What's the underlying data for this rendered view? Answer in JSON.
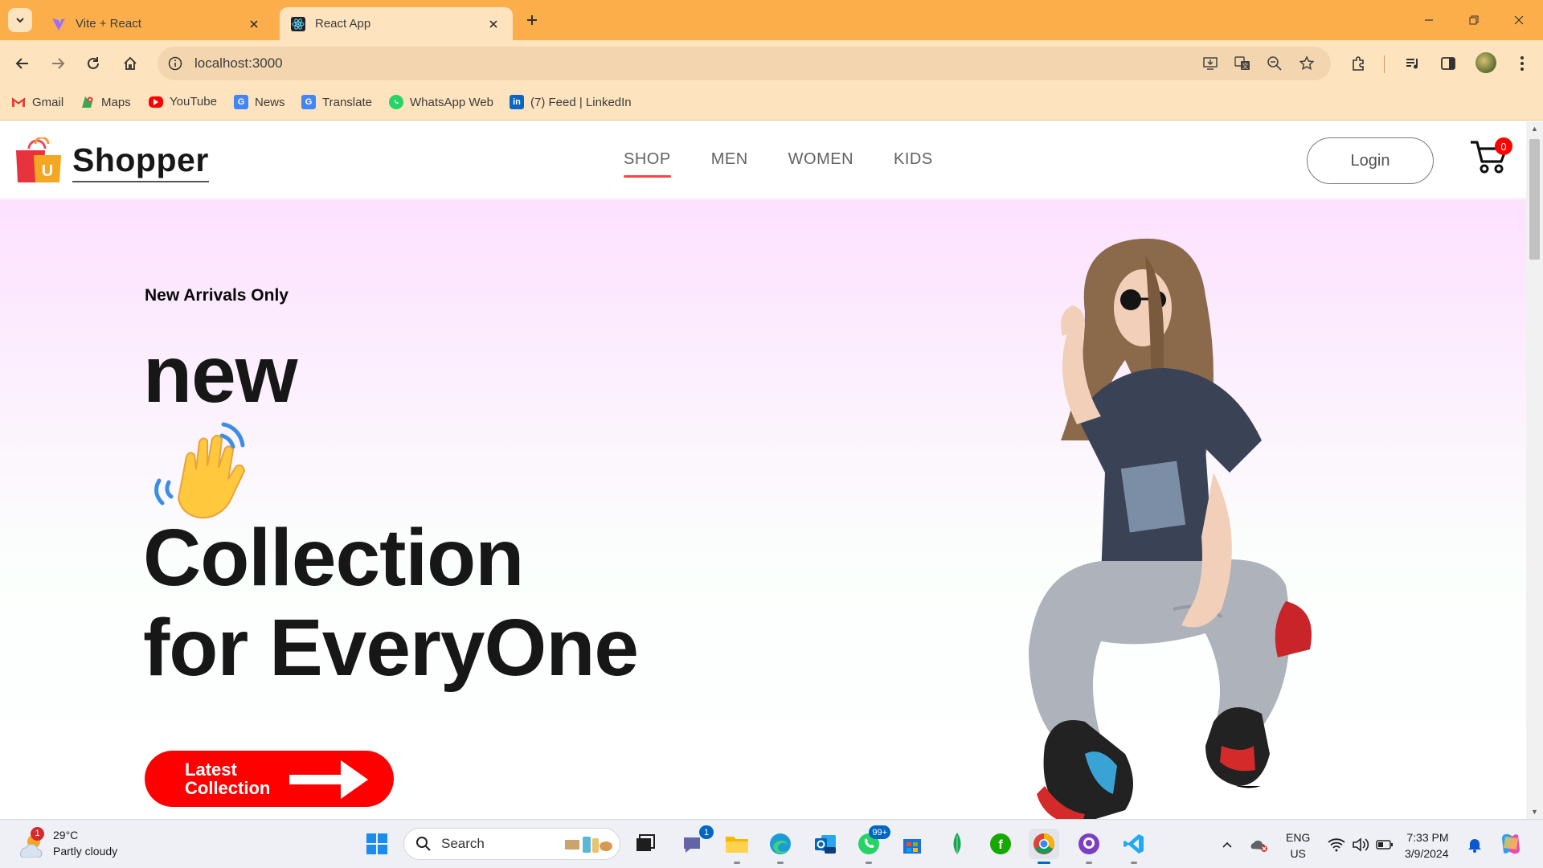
{
  "browser": {
    "tabs": [
      {
        "title": "Vite + React",
        "active": false
      },
      {
        "title": "React App",
        "active": true
      }
    ],
    "url": "localhost:3000",
    "bookmarks": [
      {
        "label": "Gmail",
        "icon": "gmail-icon"
      },
      {
        "label": "Maps",
        "icon": "maps-icon"
      },
      {
        "label": "YouTube",
        "icon": "youtube-icon"
      },
      {
        "label": "News",
        "icon": "news-icon"
      },
      {
        "label": "Translate",
        "icon": "translate-icon"
      },
      {
        "label": "WhatsApp Web",
        "icon": "whatsapp-icon"
      },
      {
        "label": "(7) Feed | LinkedIn",
        "icon": "linkedin-icon"
      }
    ]
  },
  "site": {
    "logo_text": "Shopper",
    "logo_badge": "U",
    "menu": [
      {
        "label": "SHOP",
        "active": true
      },
      {
        "label": "MEN",
        "active": false
      },
      {
        "label": "WOMEN",
        "active": false
      },
      {
        "label": "KIDS",
        "active": false
      }
    ],
    "login_label": "Login",
    "cart_count": "0",
    "colors": {
      "accent": "#ff4141",
      "cta": "#ff0000",
      "hero_top": "#fde1ff"
    }
  },
  "hero": {
    "kicker": "New Arrivals Only",
    "line1": "new",
    "line2": "Collection",
    "line3": "for EveryOne",
    "button_line1": "Latest",
    "button_line2": "Collection"
  },
  "taskbar": {
    "weather_temp": "29°C",
    "weather_desc": "Partly cloudy",
    "weather_badge": "1",
    "search_placeholder": "Search",
    "teams_badge": "1",
    "whatsapp_badge": "99+",
    "lang_line1": "ENG",
    "lang_line2": "US",
    "time": "7:33 PM",
    "date": "3/9/2024"
  }
}
